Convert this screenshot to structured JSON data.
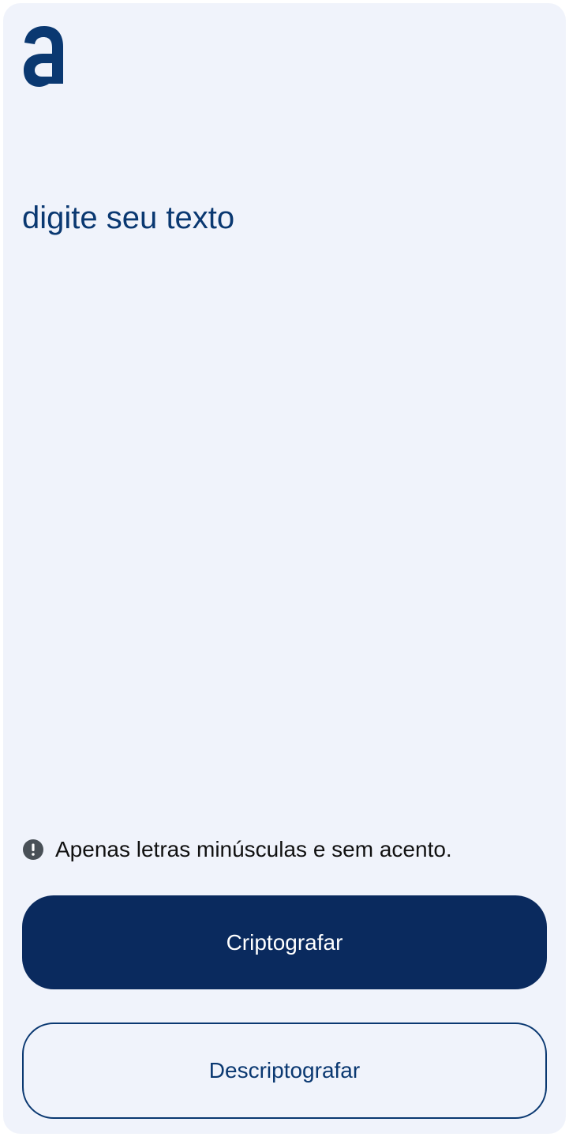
{
  "brand": {
    "logo_icon": "alura-a-logo-icon",
    "color": "#0A3871"
  },
  "editor": {
    "placeholder": "digite seu texto",
    "value": ""
  },
  "hint": {
    "icon": "exclamation-circle-icon",
    "text": "Apenas letras minúsculas e sem acento."
  },
  "actions": {
    "encrypt_label": "Criptografar",
    "decrypt_label": "Descriptografar"
  },
  "colors": {
    "background": "#F0F3FB",
    "primary": "#0A2A5E",
    "accent": "#0A3871",
    "hint_icon": "#495057"
  }
}
